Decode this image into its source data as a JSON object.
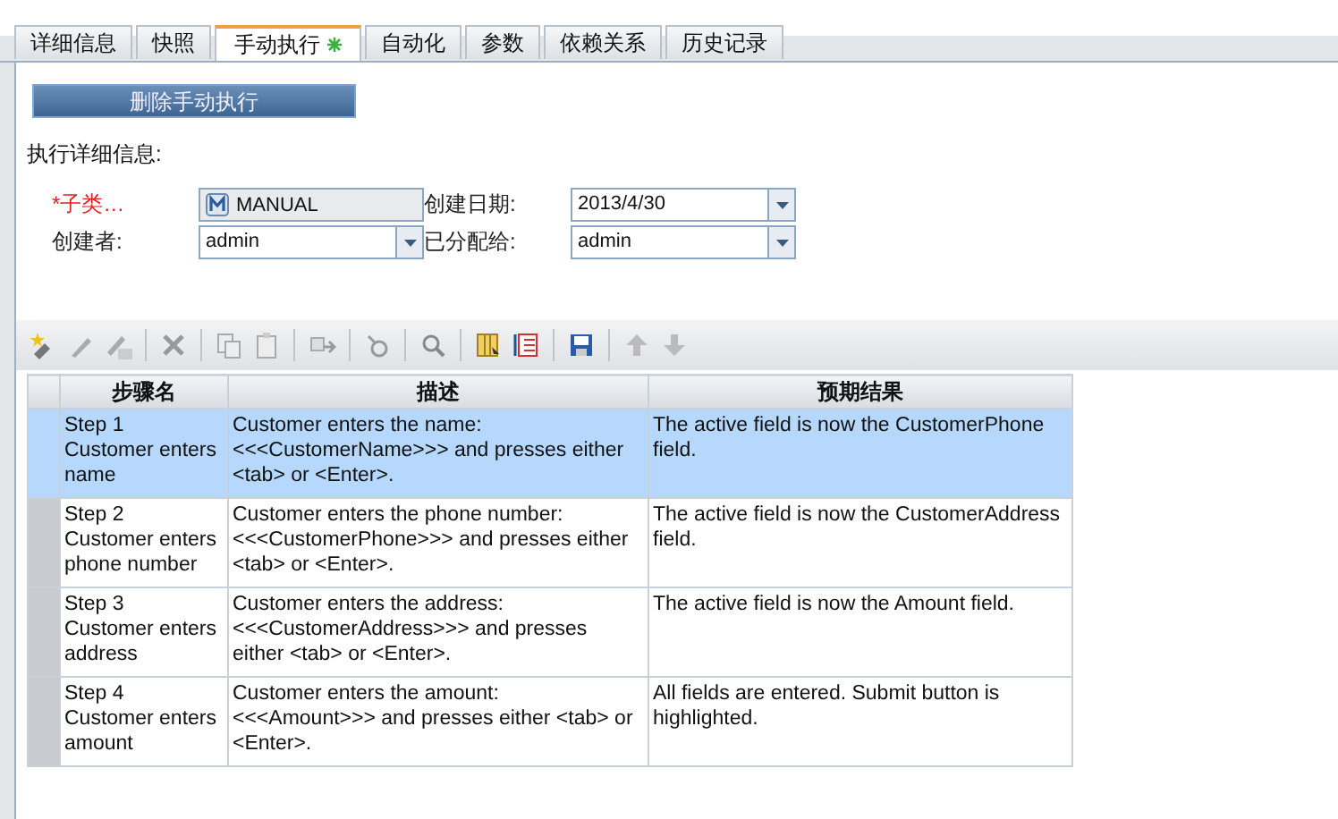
{
  "tabs": [
    {
      "label": "详细信息",
      "selected": false,
      "modified": false
    },
    {
      "label": "快照",
      "selected": false,
      "modified": false
    },
    {
      "label": "手动执行",
      "selected": true,
      "modified": true
    },
    {
      "label": "自动化",
      "selected": false,
      "modified": false
    },
    {
      "label": "参数",
      "selected": false,
      "modified": false
    },
    {
      "label": "依赖关系",
      "selected": false,
      "modified": false
    },
    {
      "label": "历史记录",
      "selected": false,
      "modified": false
    }
  ],
  "delete_button": "删除手动执行",
  "section_title": "执行详细信息:",
  "fields": [
    {
      "label": "*子类…",
      "required": true,
      "kind": "readonly",
      "value": "MANUAL"
    },
    {
      "label": "创建日期:",
      "required": false,
      "kind": "dropdown",
      "value": "2013/4/30"
    },
    {
      "label": "创建者:",
      "required": false,
      "kind": "dropdown",
      "value": "admin"
    },
    {
      "label": "已分配给:",
      "required": false,
      "kind": "dropdown",
      "value": "admin"
    }
  ],
  "table": {
    "columns": [
      "步骤名",
      "描述",
      "预期结果"
    ],
    "rows": [
      {
        "selected": true,
        "name": "Step 1\nCustomer enters name",
        "description": "Customer enters the name: <<<CustomerName>>> and presses either <tab> or <Enter>.",
        "expected": "The active field is now the CustomerPhone field."
      },
      {
        "selected": false,
        "name": "Step 2\nCustomer enters phone number",
        "description": "Customer enters the phone number: <<<CustomerPhone>>> and presses either <tab> or <Enter>.",
        "expected": "The active field is now the CustomerAddress field."
      },
      {
        "selected": false,
        "name": "Step 3\nCustomer enters address",
        "description": "Customer enters the address: <<<CustomerAddress>>> and presses either <tab> or <Enter>.",
        "expected": " The active field is now the Amount field."
      },
      {
        "selected": false,
        "name": "Step 4\nCustomer enters amount",
        "description": "Customer enters the amount: <<<Amount>>> and presses either <tab> or <Enter>.",
        "expected": "All fields are entered. Submit button is highlighted."
      }
    ]
  }
}
